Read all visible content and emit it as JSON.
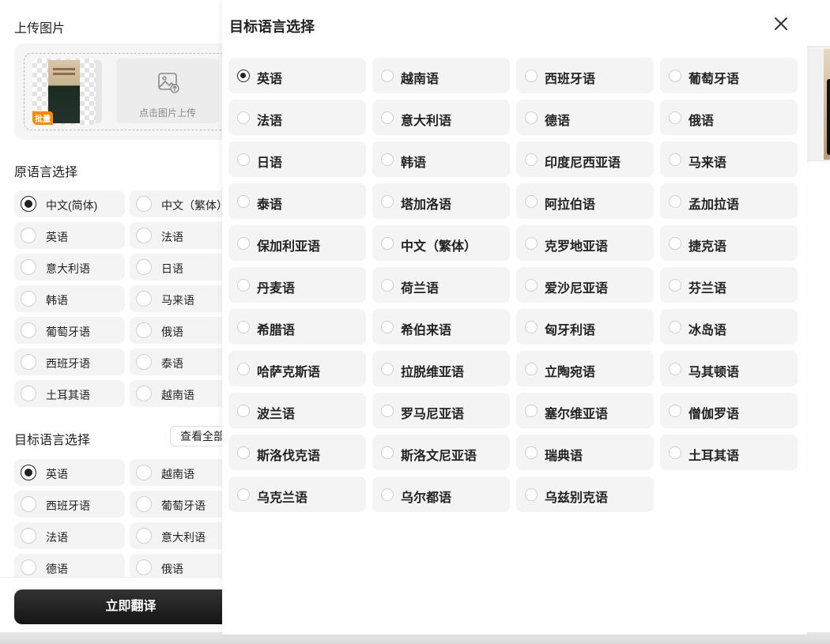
{
  "left": {
    "upload_title": "上传图片",
    "batch_badge": "批量",
    "upload_button_label": "点击图片上传",
    "source_title": "原语言选择",
    "source_options": [
      {
        "label": "中文(简体)",
        "selected": true
      },
      {
        "label": "中文（繁体）",
        "selected": false
      },
      {
        "label": "英语",
        "selected": false
      },
      {
        "label": "法语",
        "selected": false
      },
      {
        "label": "意大利语",
        "selected": false
      },
      {
        "label": "日语",
        "selected": false
      },
      {
        "label": "韩语",
        "selected": false
      },
      {
        "label": "马来语",
        "selected": false
      },
      {
        "label": "葡萄牙语",
        "selected": false
      },
      {
        "label": "俄语",
        "selected": false
      },
      {
        "label": "西班牙语",
        "selected": false
      },
      {
        "label": "泰语",
        "selected": false
      },
      {
        "label": "土耳其语",
        "selected": false
      },
      {
        "label": "越南语",
        "selected": false
      }
    ],
    "target_title": "目标语言选择",
    "view_all_label": "查看全部",
    "target_options": [
      {
        "label": "英语",
        "selected": true
      },
      {
        "label": "越南语",
        "selected": false
      },
      {
        "label": "西班牙语",
        "selected": false
      },
      {
        "label": "葡萄牙语",
        "selected": false
      },
      {
        "label": "法语",
        "selected": false
      },
      {
        "label": "意大利语",
        "selected": false
      },
      {
        "label": "德语",
        "selected": false
      },
      {
        "label": "俄语",
        "selected": false
      }
    ],
    "translate_button": "立即翻译"
  },
  "modal": {
    "title": "目标语言选择",
    "close_icon": "close-icon",
    "languages": [
      {
        "label": "英语",
        "selected": true
      },
      {
        "label": "越南语",
        "selected": false
      },
      {
        "label": "西班牙语",
        "selected": false
      },
      {
        "label": "葡萄牙语",
        "selected": false
      },
      {
        "label": "法语",
        "selected": false
      },
      {
        "label": "意大利语",
        "selected": false
      },
      {
        "label": "德语",
        "selected": false
      },
      {
        "label": "俄语",
        "selected": false
      },
      {
        "label": "日语",
        "selected": false
      },
      {
        "label": "韩语",
        "selected": false
      },
      {
        "label": "印度尼西亚语",
        "selected": false
      },
      {
        "label": "马来语",
        "selected": false
      },
      {
        "label": "泰语",
        "selected": false
      },
      {
        "label": "塔加洛语",
        "selected": false
      },
      {
        "label": "阿拉伯语",
        "selected": false
      },
      {
        "label": "孟加拉语",
        "selected": false
      },
      {
        "label": "保加利亚语",
        "selected": false
      },
      {
        "label": "中文（繁体）",
        "selected": false
      },
      {
        "label": "克罗地亚语",
        "selected": false
      },
      {
        "label": "捷克语",
        "selected": false
      },
      {
        "label": "丹麦语",
        "selected": false
      },
      {
        "label": "荷兰语",
        "selected": false
      },
      {
        "label": "爱沙尼亚语",
        "selected": false
      },
      {
        "label": "芬兰语",
        "selected": false
      },
      {
        "label": "希腊语",
        "selected": false
      },
      {
        "label": "希伯来语",
        "selected": false
      },
      {
        "label": "匈牙利语",
        "selected": false
      },
      {
        "label": "冰岛语",
        "selected": false
      },
      {
        "label": "哈萨克斯语",
        "selected": false
      },
      {
        "label": "拉脱维亚语",
        "selected": false
      },
      {
        "label": "立陶宛语",
        "selected": false
      },
      {
        "label": "马其顿语",
        "selected": false
      },
      {
        "label": "波兰语",
        "selected": false
      },
      {
        "label": "罗马尼亚语",
        "selected": false
      },
      {
        "label": "塞尔维亚语",
        "selected": false
      },
      {
        "label": "僧伽罗语",
        "selected": false
      },
      {
        "label": "斯洛伐克语",
        "selected": false
      },
      {
        "label": "斯洛文尼亚语",
        "selected": false
      },
      {
        "label": "瑞典语",
        "selected": false
      },
      {
        "label": "土耳其语",
        "selected": false
      },
      {
        "label": "乌克兰语",
        "selected": false
      },
      {
        "label": "乌尔都语",
        "selected": false
      },
      {
        "label": "乌兹别克语",
        "selected": false
      }
    ]
  },
  "colors": {
    "primary_dark": "#1a1a1a",
    "option_bg": "#f4f4f4",
    "badge_orange": "#ff8a00"
  }
}
